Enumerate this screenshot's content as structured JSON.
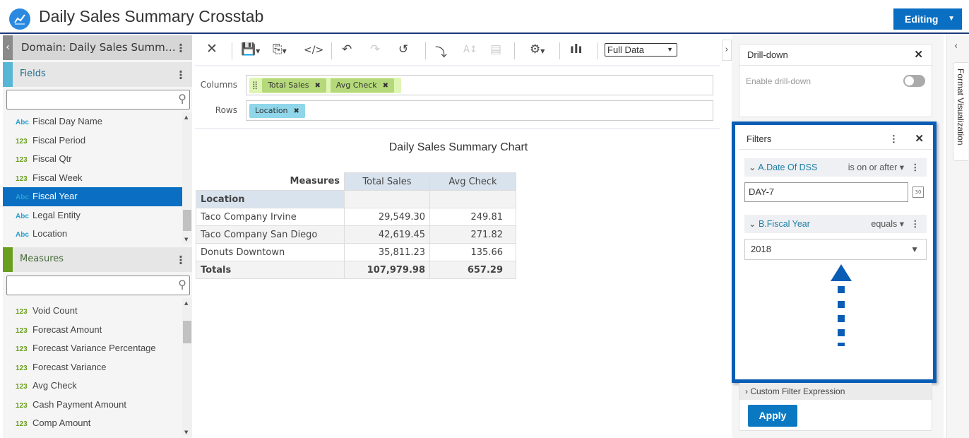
{
  "header": {
    "title": "Daily Sales Summary Crosstab",
    "mode_button": "Editing"
  },
  "left_panel": {
    "domain_title": "Domain: Daily Sales Summ…",
    "fields": {
      "title": "Fields",
      "search_value": "",
      "items": [
        {
          "type": "Abc",
          "label": "Fiscal Day Name"
        },
        {
          "type": "123",
          "label": "Fiscal Period"
        },
        {
          "type": "123",
          "label": "Fiscal Qtr"
        },
        {
          "type": "123",
          "label": "Fiscal Week"
        },
        {
          "type": "Abc",
          "label": "Fiscal Year",
          "selected": true
        },
        {
          "type": "Abc",
          "label": "Legal Entity"
        },
        {
          "type": "Abc",
          "label": "Location"
        }
      ]
    },
    "measures": {
      "title": "Measures",
      "search_value": "",
      "items": [
        {
          "type": "123",
          "label": "Void Count"
        },
        {
          "type": "123",
          "label": "Forecast Amount"
        },
        {
          "type": "123",
          "label": "Forecast Variance Percentage"
        },
        {
          "type": "123",
          "label": "Forecast Variance"
        },
        {
          "type": "123",
          "label": "Avg Check"
        },
        {
          "type": "123",
          "label": "Cash Payment Amount"
        },
        {
          "type": "123",
          "label": "Comp Amount"
        }
      ]
    }
  },
  "toolbar": {
    "data_mode": "Full Data",
    "icons": [
      "close-icon",
      "save-icon",
      "export-icon",
      "code-icon",
      "undo-icon",
      "redo-icon",
      "reset-icon",
      "pivot-icon",
      "sort-icon",
      "layout-icon",
      "settings-icon",
      "chart-type-icon"
    ]
  },
  "query": {
    "columns_label": "Columns",
    "rows_label": "Rows",
    "columns": [
      "Total Sales",
      "Avg Check"
    ],
    "rows": [
      "Location"
    ]
  },
  "report": {
    "title": "Daily Sales Summary Chart",
    "measures_label": "Measures",
    "row_header": "Location",
    "col_headers": [
      "Total Sales",
      "Avg Check"
    ],
    "rows": [
      {
        "label": "Taco Company Irvine",
        "values": [
          "29,549.30",
          "249.81"
        ]
      },
      {
        "label": "Taco Company San Diego",
        "values": [
          "42,619.45",
          "271.82"
        ]
      },
      {
        "label": "Donuts Downtown",
        "values": [
          "35,811.23",
          "135.66"
        ]
      }
    ],
    "totals": {
      "label": "Totals",
      "values": [
        "107,979.98",
        "657.29"
      ]
    }
  },
  "right_panel": {
    "drilldown": {
      "title": "Drill-down",
      "toggle_label": "Enable drill-down",
      "enabled": false
    },
    "filters": {
      "title": "Filters",
      "items": [
        {
          "name": "A.Date Of DSS",
          "operator": "is on or after",
          "value": "DAY-7"
        },
        {
          "name": "B.Fiscal Year",
          "operator": "equals",
          "value": "2018"
        }
      ]
    },
    "custom_filter": "Custom Filter Expression",
    "apply": "Apply",
    "format_tab": "Format Visualization"
  },
  "colors": {
    "accent": "#0a6fc2",
    "highlight": "#0a5db5",
    "fields_stripe": "#56b6d6",
    "measures_stripe": "#6a9e1f",
    "column_pill": "#b5d97a",
    "row_pill": "#8fd6ea"
  }
}
